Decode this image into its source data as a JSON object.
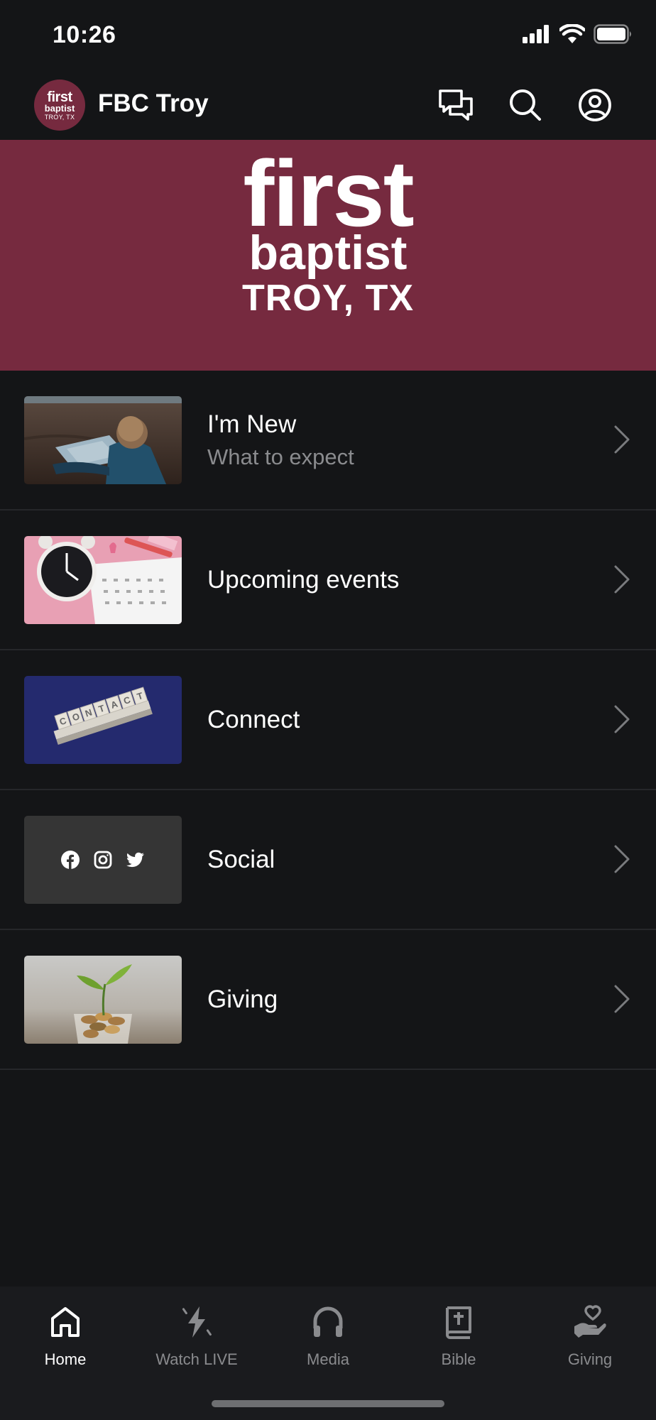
{
  "status_bar": {
    "time": "10:26"
  },
  "header": {
    "logo": {
      "first": "first",
      "baptist": "baptist",
      "location": "TROY, TX"
    },
    "title": "FBC Troy",
    "icons": [
      "chat-bubbles-icon",
      "search-icon",
      "account-icon"
    ]
  },
  "banner": {
    "first": "first",
    "baptist": "baptist",
    "location": "TROY, TX"
  },
  "menu": {
    "items": [
      {
        "title": "I'm New",
        "subtitle": "What to expect",
        "thumbnail": "map-reading-photo"
      },
      {
        "title": "Upcoming events",
        "thumbnail": "clock-calendar-photo"
      },
      {
        "title": "Connect",
        "thumbnail": "contact-tiles-photo"
      },
      {
        "title": "Social",
        "thumbnail": "social-icons-tile",
        "icons": [
          "facebook-icon",
          "instagram-icon",
          "twitter-icon"
        ]
      },
      {
        "title": "Giving",
        "thumbnail": "plant-coins-photo"
      }
    ]
  },
  "tabs": {
    "items": [
      {
        "label": "Home",
        "icon": "home-icon",
        "active": true
      },
      {
        "label": "Watch LIVE",
        "icon": "lightning-icon",
        "active": false
      },
      {
        "label": "Media",
        "icon": "headphones-icon",
        "active": false
      },
      {
        "label": "Bible",
        "icon": "bible-icon",
        "active": false
      },
      {
        "label": "Giving",
        "icon": "heart-hand-icon",
        "active": false
      }
    ]
  },
  "colors": {
    "brand": "#762a3f",
    "background": "#141517",
    "tab_bar": "#1a1b1e",
    "muted": "#8a8b8e"
  }
}
